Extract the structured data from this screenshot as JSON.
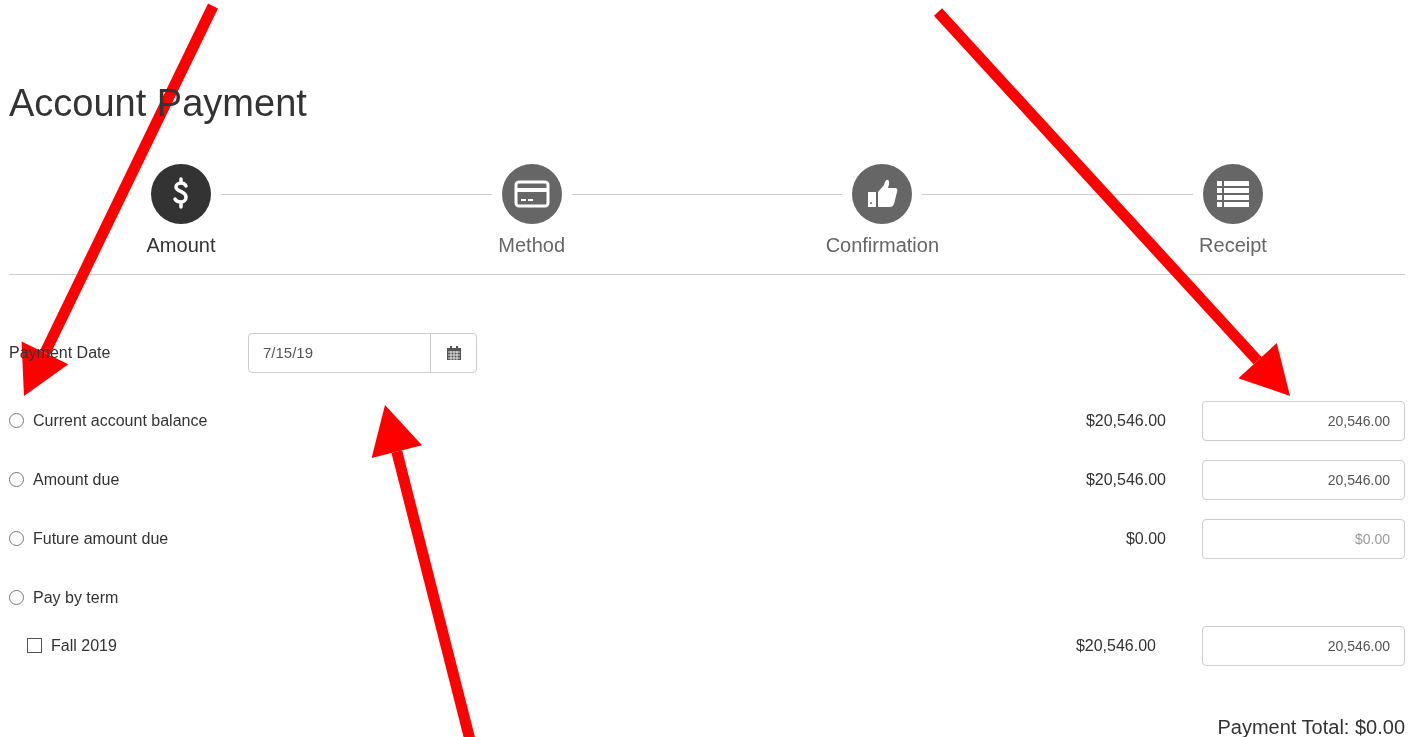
{
  "title": "Account Payment",
  "steps": [
    {
      "label": "Amount",
      "selected": true
    },
    {
      "label": "Method",
      "selected": false
    },
    {
      "label": "Confirmation",
      "selected": false
    },
    {
      "label": "Receipt",
      "selected": false
    }
  ],
  "payment_date": {
    "label": "Payment Date",
    "value": "7/15/19"
  },
  "options": [
    {
      "kind": "radio",
      "label": "Current account balance",
      "selected": false,
      "amount": "$20,546.00",
      "value": "20,546.00"
    },
    {
      "kind": "radio",
      "label": "Amount due",
      "selected": false,
      "amount": "$20,546.00",
      "value": "20,546.00"
    },
    {
      "kind": "radio",
      "label": "Future amount due",
      "selected": false,
      "amount": "$0.00",
      "placeholder": "$0.00"
    },
    {
      "kind": "radio",
      "label": "Pay by term",
      "selected": false
    },
    {
      "kind": "checkbox",
      "label": "Fall 2019",
      "checked": false,
      "amount": "$20,546.00",
      "value": "20,546.00"
    }
  ],
  "payment_total": "Payment Total: $0.00"
}
